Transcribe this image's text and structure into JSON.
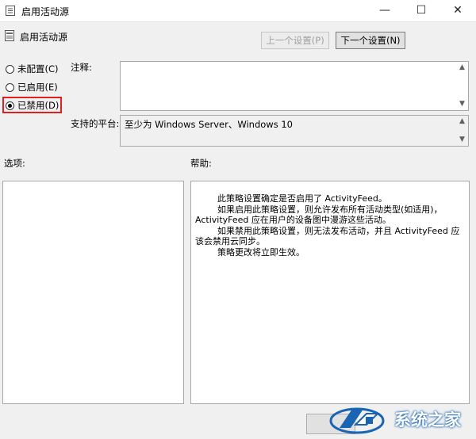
{
  "window": {
    "title": "启用活动源",
    "controls": [
      "—",
      "☐",
      "✕"
    ]
  },
  "policy": {
    "name": "启用活动源"
  },
  "nav": {
    "prev_label": "上一个设置(P)",
    "next_label": "下一个设置(N)"
  },
  "radios": [
    {
      "label": "未配置(C)",
      "checked": false
    },
    {
      "label": "已启用(E)",
      "checked": false
    },
    {
      "label": "已禁用(D)",
      "checked": true
    }
  ],
  "comment": {
    "label": "注释:",
    "value": ""
  },
  "platform": {
    "label": "支持的平台:",
    "value": "至少为 Windows Server、Windows 10"
  },
  "options": {
    "label": "选项:"
  },
  "help": {
    "label": "帮助:",
    "text": "        此策略设置确定是否启用了 ActivityFeed。\n        如果启用此策略设置，则允许发布所有活动类型(如适用)，ActivityFeed 应在用户的设备图中漫游这些活动。\n        如果禁用此策略设置，则无法发布活动，并且 ActivityFeed 应该会禁用云同步。\n        策略更改将立即生效。"
  },
  "watermark": {
    "text": "系统之家"
  },
  "colors": {
    "highlight_box": "#e02020",
    "watermark_blue": "#1a64b4"
  }
}
